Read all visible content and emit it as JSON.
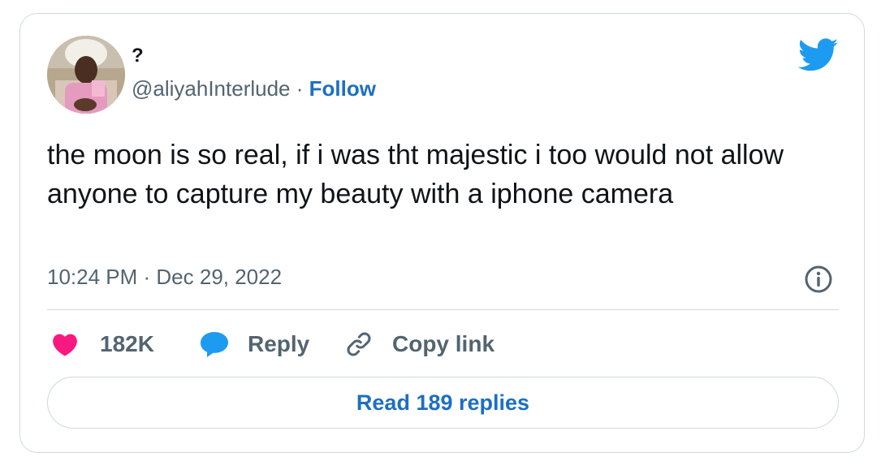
{
  "author": {
    "display_name": "?",
    "handle": "@aliyahInterlude",
    "separator": "·",
    "follow_label": "Follow"
  },
  "tweet": {
    "text": "the moon is so real, if i was tht majestic i too would not allow anyone to capture my beauty with a iphone camera",
    "timestamp": "10:24 PM · Dec 29, 2022"
  },
  "actions": {
    "likes_count": "182K",
    "reply_label": "Reply",
    "copy_label": "Copy link",
    "read_replies_label": "Read 189 replies"
  },
  "colors": {
    "brand_blue": "#1d9bf0",
    "link_blue": "#1d6fc2",
    "like_pink": "#f91880",
    "muted_text": "#536471"
  },
  "icons": {
    "brand": "twitter-bird-icon",
    "info": "info-icon",
    "like": "heart-icon",
    "reply": "speech-bubble-icon",
    "copy": "link-icon"
  }
}
